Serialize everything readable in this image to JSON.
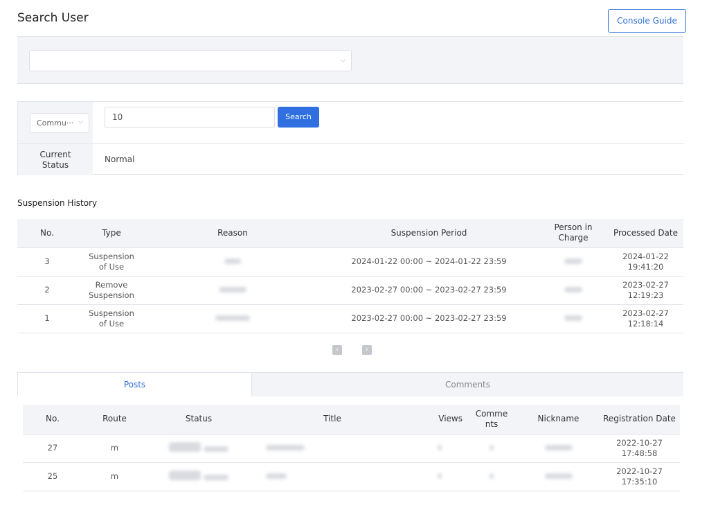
{
  "page": {
    "title": "Search User",
    "guide_button": "Console Guide"
  },
  "filter": {
    "selected_value": ""
  },
  "search": {
    "type_select": "Commu···",
    "input_value": "10",
    "button": "Search",
    "status_label": "Current Status",
    "status_value": "Normal"
  },
  "suspension": {
    "title": "Suspension History",
    "columns": [
      "No.",
      "Type",
      "Reason",
      "Suspension Period",
      "Person in Charge",
      "Processed Date"
    ],
    "rows": [
      {
        "no": "3",
        "type": "Suspension of Use",
        "period": "2024-01-22 00:00 ~ 2024-01-22 23:59",
        "date": "2024-01-22 19:41:20"
      },
      {
        "no": "2",
        "type": "Remove Suspension",
        "period": "2023-02-27 00:00 ~ 2023-02-27 23:59",
        "date": "2023-02-27 12:19:23"
      },
      {
        "no": "1",
        "type": "Suspension of Use",
        "period": "2023-02-27 00:00 ~ 2023-02-27 23:59",
        "date": "2023-02-27 12:18:14"
      }
    ]
  },
  "tabs": {
    "posts": "Posts",
    "comments": "Comments"
  },
  "posts": {
    "columns": [
      "No.",
      "Route",
      "Status",
      "Title",
      "Views",
      "Comments",
      "Nickname",
      "Registration Date"
    ],
    "rows": [
      {
        "no": "27",
        "route": "m",
        "date": "2022-10-27 17:48:58"
      },
      {
        "no": "25",
        "route": "m",
        "date": "2022-10-27 17:35:10"
      }
    ]
  }
}
